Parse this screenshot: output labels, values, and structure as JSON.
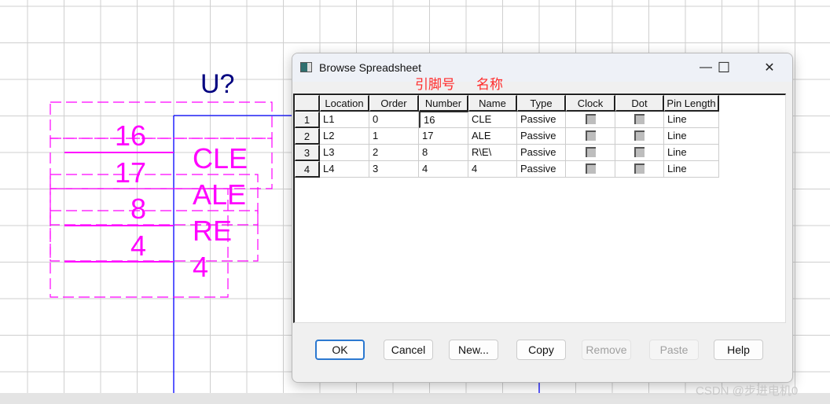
{
  "schematic": {
    "designator": "U?",
    "pin_numbers": [
      "16",
      "17",
      "8",
      "4"
    ],
    "pin_names": [
      "CLE",
      "ALE",
      "RE",
      "4"
    ],
    "colors": {
      "pin_text": "#ff00ff",
      "body": "#0000ff",
      "designator": "#000080",
      "grid": "#c8c8c8"
    }
  },
  "dialog": {
    "title": "Browse Spreadsheet",
    "annotation_pin_number": "引脚号",
    "annotation_name": "名称",
    "window_controls": {
      "minimize": "—",
      "maximize": "☐",
      "close": "✕"
    },
    "columns": [
      "Location",
      "Order",
      "Number",
      "Name",
      "Type",
      "Clock",
      "Dot",
      "Pin Length"
    ],
    "rows": [
      {
        "index": "1",
        "location": "L1",
        "order": "0",
        "number": "16",
        "name": "CLE",
        "type": "Passive",
        "clock": false,
        "dot": false,
        "pin_length": "Line"
      },
      {
        "index": "2",
        "location": "L2",
        "order": "1",
        "number": "17",
        "name": "ALE",
        "type": "Passive",
        "clock": false,
        "dot": false,
        "pin_length": "Line"
      },
      {
        "index": "3",
        "location": "L3",
        "order": "2",
        "number": "8",
        "name": "R\\E\\",
        "type": "Passive",
        "clock": false,
        "dot": false,
        "pin_length": "Line"
      },
      {
        "index": "4",
        "location": "L4",
        "order": "3",
        "number": "4",
        "name": "4",
        "type": "Passive",
        "clock": false,
        "dot": false,
        "pin_length": "Line"
      }
    ],
    "buttons": {
      "ok": "OK",
      "cancel": "Cancel",
      "new": "New...",
      "copy": "Copy",
      "remove": "Remove",
      "paste": "Paste",
      "help": "Help"
    }
  },
  "watermark": "CSDN @步进电机0"
}
